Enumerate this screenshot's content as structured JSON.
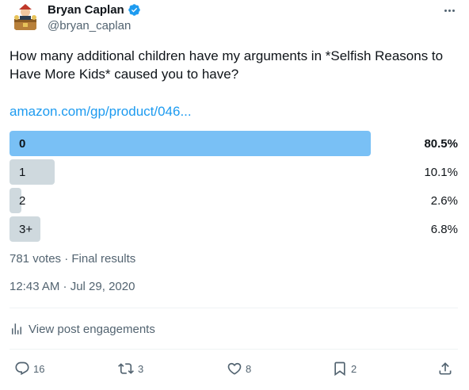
{
  "author": {
    "display_name": "Bryan Caplan",
    "handle": "@bryan_caplan",
    "verified": true
  },
  "post": {
    "text": "How many additional children have my arguments in *Selfish Reasons to Have More Kids* caused you to have?",
    "link": "amazon.com/gp/product/046..."
  },
  "poll": {
    "options": [
      {
        "label": "0",
        "percent_text": "80.5%",
        "percent": 80.5,
        "winner": true
      },
      {
        "label": "1",
        "percent_text": "10.1%",
        "percent": 10.1,
        "winner": false
      },
      {
        "label": "2",
        "percent_text": "2.6%",
        "percent": 2.6,
        "winner": false
      },
      {
        "label": "3+",
        "percent_text": "6.8%",
        "percent": 6.8,
        "winner": false
      }
    ],
    "summary": "781 votes · Final results"
  },
  "timestamp": "12:43 AM · Jul 29, 2020",
  "engagements_label": "View post engagements",
  "actions": {
    "replies": "16",
    "reposts": "3",
    "likes": "8",
    "bookmarks": "2"
  },
  "colors": {
    "accent": "#1d9bf0",
    "winner_bar": "#79c0f5",
    "bar": "#cfd9de",
    "muted_text": "#536471"
  },
  "icons": [
    "verified-badge-icon",
    "more-icon",
    "analytics-icon",
    "reply-icon",
    "repost-icon",
    "like-icon",
    "bookmark-icon",
    "share-icon"
  ]
}
